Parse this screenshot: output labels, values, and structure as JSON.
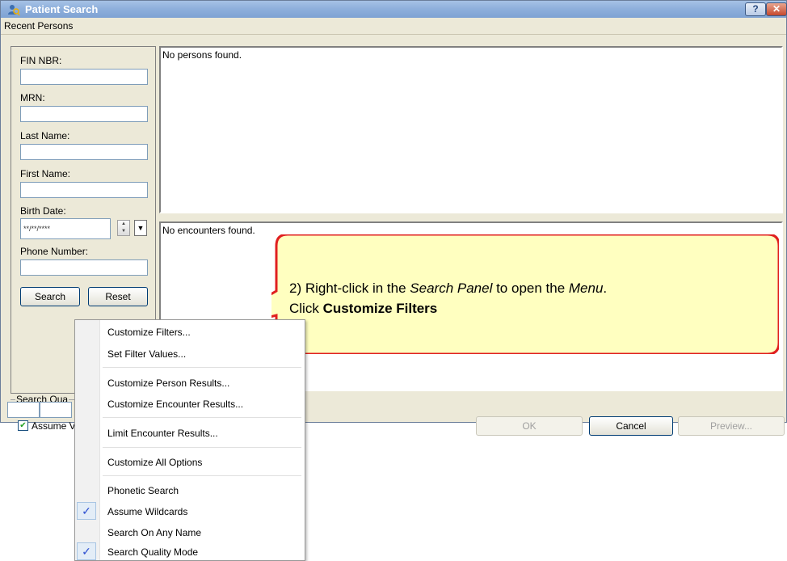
{
  "window": {
    "title": "Patient Search",
    "help_button": "?",
    "close_button": "✕"
  },
  "menubar": {
    "recent_persons": "Recent Persons"
  },
  "search_panel": {
    "fin_label": "FIN NBR:",
    "mrn_label": "MRN:",
    "last_name_label": "Last Name:",
    "first_name_label": "First Name:",
    "birth_date_label": "Birth Date:",
    "birth_date_value": "**/**/****",
    "phone_label": "Phone Number:",
    "search_button": "Search",
    "reset_button": "Reset"
  },
  "results": {
    "persons_empty": "No persons found.",
    "encounters_empty": "No encounters found."
  },
  "search_quality": {
    "label": "Search Qua",
    "assume_label": "Assume V"
  },
  "buttons": {
    "ok": "OK",
    "cancel": "Cancel",
    "preview": "Preview..."
  },
  "context_menu": {
    "items": [
      "Customize Filters...",
      "Set Filter Values...",
      "Customize Person Results...",
      "Customize Encounter Results...",
      "Limit Encounter Results...",
      "Customize All Options",
      "Phonetic Search",
      "Assume Wildcards",
      "Search On Any Name",
      "Search Quality Mode"
    ],
    "checked": [
      "Assume Wildcards",
      "Search Quality Mode"
    ],
    "check_glyph": "✓"
  },
  "callout": {
    "line1_prefix": "2) Right-click in the ",
    "line1_em1": "Search Panel",
    "line1_mid": " to open the ",
    "line1_em2": "Menu",
    "line1_end": ".",
    "line2_prefix": "Click ",
    "line2_bold": "Customize Filters"
  },
  "colors": {
    "callout_fill": "#ffffc0",
    "callout_border": "#e02020",
    "titlebar": "#8fb0dc"
  }
}
